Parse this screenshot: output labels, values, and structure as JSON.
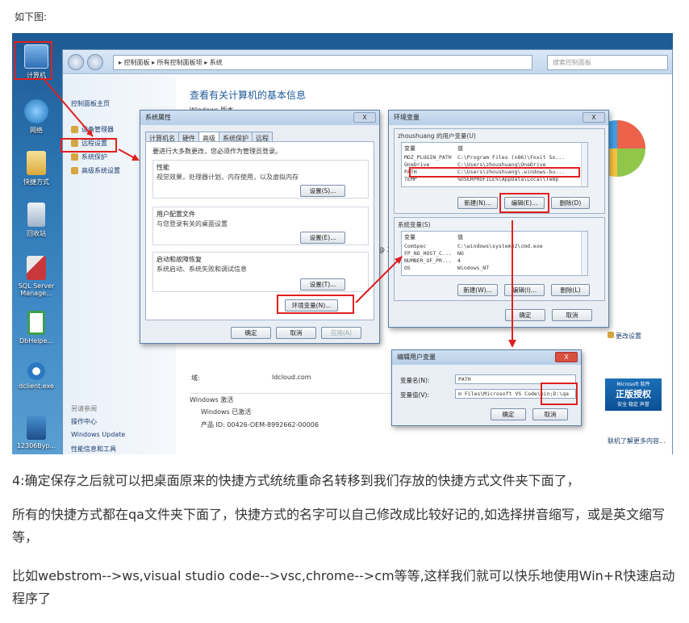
{
  "intro": "如下图:",
  "desktop": {
    "icons": [
      {
        "label": "计算机",
        "name": "computer-icon",
        "color": "#4a8fd6"
      },
      {
        "label": "网络",
        "name": "network-icon",
        "color": "#3a9ad9"
      },
      {
        "label": "快捷方式",
        "name": "folder-icon",
        "color": "#e6c25a"
      },
      {
        "label": "回收站",
        "name": "recycle-bin-icon",
        "color": "#b7c9d9"
      },
      {
        "label": "SQL Server Manage...",
        "name": "sql-server-icon",
        "color": "#c8373a"
      },
      {
        "label": "DbHelpe...",
        "name": "dbhelper-icon",
        "color": "#3c9d4c"
      },
      {
        "label": "dclient.exe",
        "name": "dclient-icon",
        "color": "#2b78c2"
      },
      {
        "label": "12306Byp...",
        "name": "app-12306-icon",
        "color": "#2a6bb0"
      }
    ]
  },
  "control_panel": {
    "breadcrumb": "▸ 控制面板 ▸ 所有控制面板项 ▸ 系统",
    "search_placeholder": "搜索控制面板",
    "side_home": "控制面板主页",
    "side_links": [
      "设备管理器",
      "远程设置",
      "系统保护",
      "高级系统设置"
    ],
    "see_also_title": "另请参阅",
    "see_also": [
      "操作中心",
      "Windows Update",
      "性能信息和工具"
    ],
    "main_title": "查看有关计算机的基本信息",
    "windows_edition": "Windows 版本",
    "domain_label": "域:",
    "domain_value": "ldcloud.com",
    "activation_title": "Windows 激活",
    "activated": "Windows 已激活",
    "product_id": "产品 ID: 00426-OEM-8992662-00006",
    "cpu_fragment": "@ 3.70",
    "change_settings": "更改设置",
    "learn_more": "联机了解更多内容...",
    "genuine": "正版授权",
    "genuine_sub": "安全 稳定 声誉",
    "genuine_brand": "Microsoft 软件"
  },
  "sys_props": {
    "title": "系统属性",
    "close": "X",
    "tabs": [
      "计算机名",
      "硬件",
      "高级",
      "系统保护",
      "远程"
    ],
    "active_tab": 2,
    "note": "要进行大多数更改，您必须作为管理员登录。",
    "perf_title": "性能",
    "perf_desc": "视觉效果，处理器计划，内存使用，以及虚拟内存",
    "profile_title": "用户配置文件",
    "profile_desc": "与您登录有关的桌面设置",
    "startup_title": "启动和故障恢复",
    "startup_desc": "系统启动、系统失败和调试信息",
    "settings_btn_1": "设置(S)...",
    "settings_btn_2": "设置(E)...",
    "settings_btn_3": "设置(T)...",
    "env_btn": "环境变量(N)...",
    "ok": "确定",
    "cancel": "取消",
    "apply": "应用(A)"
  },
  "env_vars": {
    "title": "环境变量",
    "close": "X",
    "user_section": "zhoushuang 的用户变量(U)",
    "col_var": "变量",
    "col_val": "值",
    "user_rows": [
      {
        "var": "MOZ_PLUGIN_PATH",
        "val": "C:\\Program Files (x86)\\Foxit So..."
      },
      {
        "var": "OneDrive",
        "val": "C:\\Users\\zhoushuang\\OneDrive"
      },
      {
        "var": "PATH",
        "val": "C:\\Users\\zhoushuang\\.windows-bu..."
      },
      {
        "var": "TEMP",
        "val": "%USERPROFILE%\\AppData\\Local\\Temp"
      }
    ],
    "sys_section": "系统变量(S)",
    "sys_rows": [
      {
        "var": "ComSpec",
        "val": "C:\\windows\\system32\\cmd.exe"
      },
      {
        "var": "FP_NO_HOST_C...",
        "val": "NO"
      },
      {
        "var": "NUMBER_OF_PR...",
        "val": "4"
      },
      {
        "var": "OS",
        "val": "Windows_NT"
      }
    ],
    "new_btn_1": "新建(N)...",
    "edit_btn_1": "编辑(E)...",
    "del_btn_1": "删除(D)",
    "new_btn_2": "新建(W)...",
    "edit_btn_2": "编辑(I)...",
    "del_btn_2": "删除(L)",
    "ok": "确定",
    "cancel": "取消"
  },
  "edit_var": {
    "title": "编辑用户变量",
    "close": "X",
    "name_label": "变量名(N):",
    "name_value": "PATH",
    "value_label": "变量值(V):",
    "value_value": "m Files\\Microsoft VS Code\\bin;D:\\qa",
    "ok": "确定",
    "cancel": "取消"
  },
  "paragraphs": [
    "4:确定保存之后就可以把桌面原来的快捷方式统统重命名转移到我们存放的快捷方式文件夹下面了，",
    "所有的快捷方式都在qa文件夹下面了，快捷方式的名字可以自己修改成比较好记的,如选择拼音缩写，或是英文缩写等，",
    "比如webstrom-->ws,visual studio code-->vsc,chrome-->cm等等,这样我们就可以快乐地使用Win+R快速启动程序了"
  ],
  "colors": {
    "highlight": "#e02020",
    "link": "#1e3e6e"
  }
}
